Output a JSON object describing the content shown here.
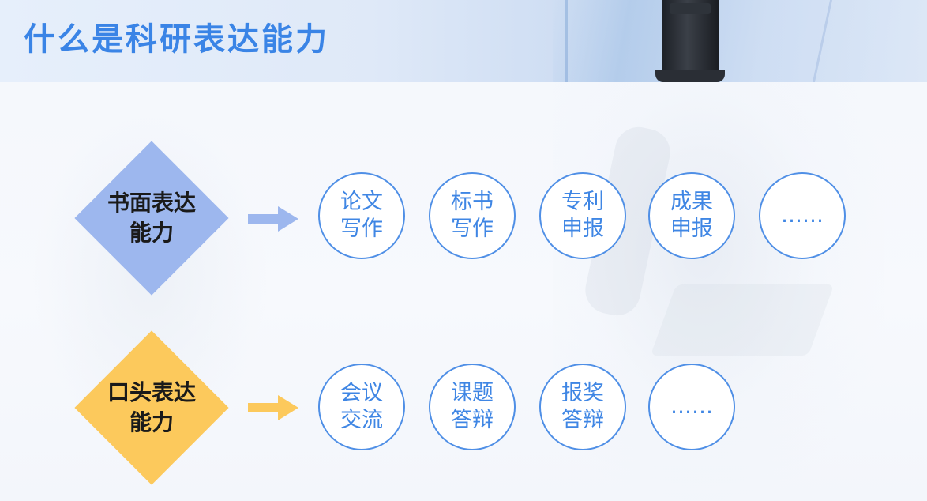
{
  "title": "什么是科研表达能力",
  "colors": {
    "title": "#3a84e6",
    "written_diamond": "#9db7ee",
    "oral_diamond": "#fcc95c",
    "circle_border": "#4f8fe6",
    "circle_text": "#3f86e4"
  },
  "written": {
    "label": "书面表达能力",
    "items": [
      "论文写作",
      "标书写作",
      "专利申报",
      "成果申报",
      "……"
    ]
  },
  "oral": {
    "label": "口头表达能力",
    "items": [
      "会议交流",
      "课题答辩",
      "报奖答辩",
      "……"
    ]
  }
}
